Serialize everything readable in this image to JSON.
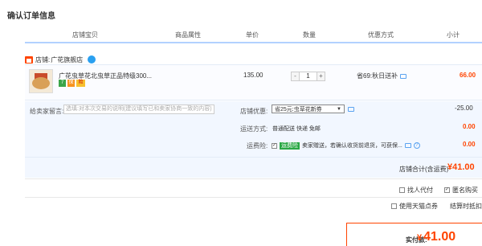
{
  "page": {
    "title": "确认订单信息"
  },
  "table_headers": [
    "店铺宝贝",
    "商品属性",
    "单价",
    "数量",
    "优惠方式",
    "小计"
  ],
  "shop": {
    "label": "店铺:",
    "name": "广花旗舰店"
  },
  "item": {
    "title": "广花虫草花北虫草正品特级300...",
    "price": "135.00",
    "quantity": "1",
    "qty_minus": "-",
    "qty_plus": "+",
    "promo": "省69:秋日送补",
    "subtotal": "66.00",
    "badges": [
      "7",
      "保",
      "险"
    ]
  },
  "memo": {
    "label": "给卖家留言:",
    "placeholder": "选填:对本次交易的说明(建议填写已和卖家协商一致的内容)"
  },
  "coupon": {
    "label": "店铺优惠:",
    "selected": "省25元:虫草花新券",
    "amount": "-25.00"
  },
  "shipping": {
    "label": "运送方式:",
    "value": "普通配送 快递 免邮",
    "amount": "0.00"
  },
  "insurance": {
    "label": "运费险:",
    "badge": "运费险",
    "text": "卖家赠送，若确认收货前退货，可获保...",
    "amount": "0.00"
  },
  "total": {
    "label": "店铺合计(含运费)",
    "value": "¥41.00"
  },
  "options": {
    "proxy_pay": "找人代付",
    "anonymous": "匿名购买",
    "tmall_points": "使用天猫点券",
    "settle": "结算时抵扣"
  },
  "payment": {
    "label": "实付款:",
    "symbol": "¥",
    "value": "41.00"
  },
  "colors": {
    "accent": "#ff4400",
    "header_line": "#b2d1ff",
    "panel_bg": "#f2f7ff"
  }
}
